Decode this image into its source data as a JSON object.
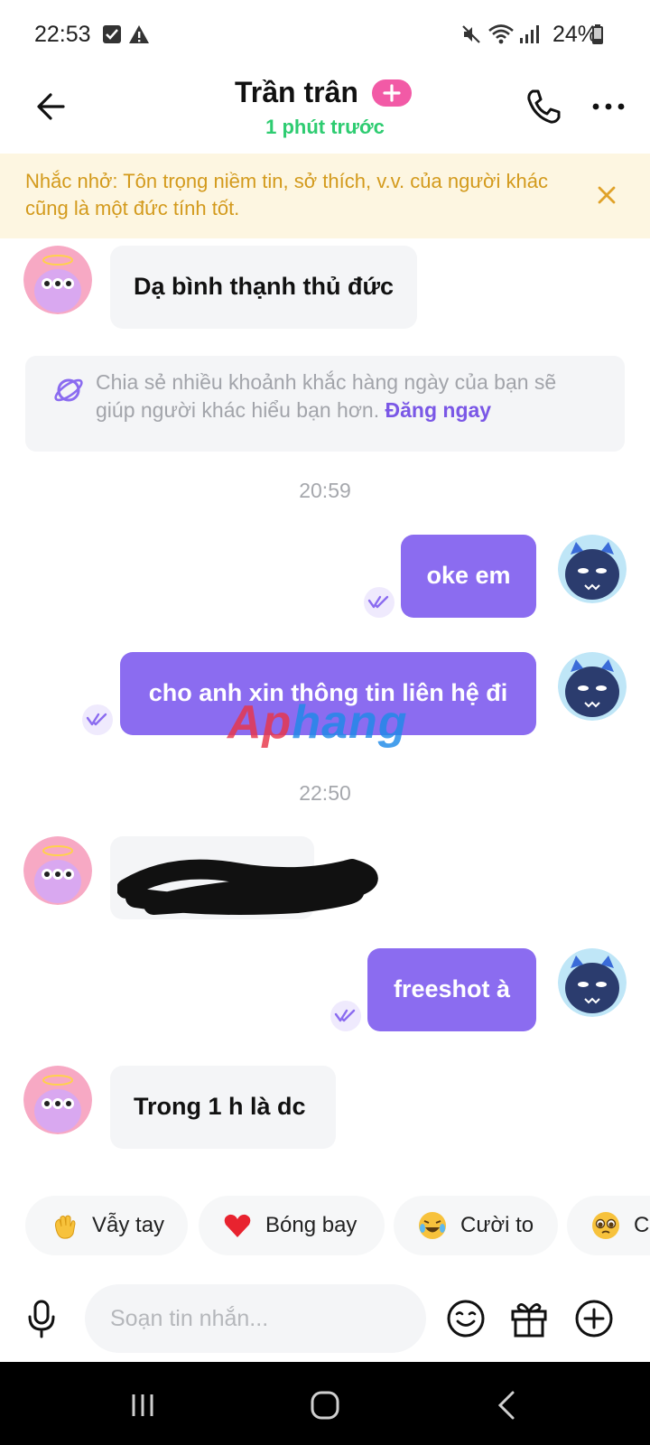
{
  "status_bar": {
    "time": "22:53",
    "battery": "24%"
  },
  "header": {
    "name": "Trần trân",
    "last_seen": "1 phút trước",
    "add_badge": "+"
  },
  "reminder": {
    "text": "Nhắc nhở: Tôn trọng niềm tin, sở thích, v.v. của người khác cũng là một đức tính tốt."
  },
  "share_card": {
    "text": "Chia sẻ nhiều khoảnh khắc hàng ngày của bạn sẽ giúp người khác hiểu bạn hơn.",
    "link": "Đăng ngay"
  },
  "messages": [
    {
      "from": "them",
      "text": "Dạ bình thạnh thủ đức"
    },
    {
      "from": "me",
      "text": "oke em"
    },
    {
      "from": "me",
      "text": "cho anh xin thông tin liên hệ đi"
    },
    {
      "from": "them",
      "text": ""
    },
    {
      "from": "me",
      "text": "freeshot à"
    },
    {
      "from": "them",
      "text": "Trong 1 h là dc"
    }
  ],
  "time_separators": [
    "20:59",
    "22:50"
  ],
  "watermark": {
    "part1": "Ap",
    "part2": "hang"
  },
  "quick_replies": [
    {
      "emoji": "waving-hand-icon",
      "label": "Vẫy tay"
    },
    {
      "emoji": "heart-icon",
      "label": "Bóng bay"
    },
    {
      "emoji": "laughing-face-icon",
      "label": "Cười to"
    },
    {
      "emoji": "pleading-face-icon",
      "label": "C"
    }
  ],
  "input": {
    "placeholder": "Soạn tin nhắn..."
  },
  "colors": {
    "accent": "#8b6cf0",
    "online": "#2ecc71",
    "reminder_text": "#d39a1c",
    "reminder_bg": "#fdf6e1",
    "badge": "#f25aa6"
  }
}
